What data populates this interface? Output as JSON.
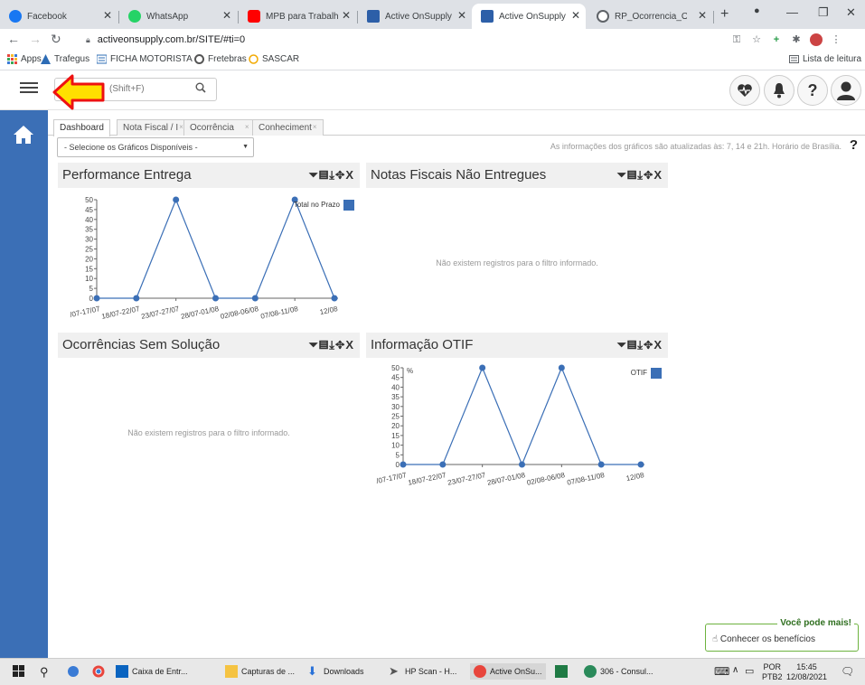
{
  "browser": {
    "tabs": [
      {
        "label": "Facebook",
        "icon": "facebook-icon",
        "color": "#1877f2",
        "active": false
      },
      {
        "label": "WhatsApp",
        "icon": "whatsapp-icon",
        "color": "#25d366",
        "active": false
      },
      {
        "label": "MPB para Trabalhar",
        "icon": "youtube-icon",
        "color": "#ff0000",
        "active": false
      },
      {
        "label": "Active OnSupply",
        "icon": "chart-icon",
        "color": "#2d5fa8",
        "active": false
      },
      {
        "label": "Active OnSupply",
        "icon": "chart-icon",
        "color": "#2d5fa8",
        "active": true
      },
      {
        "label": "RP_Ocorrencia_Oco",
        "icon": "globe-icon",
        "color": "#5f6368",
        "active": false
      }
    ],
    "url": "activeonsupply.com.br/SITE/#ti=0",
    "bookmarks": [
      {
        "label": "Apps",
        "icon": "apps-grid-icon"
      },
      {
        "label": "Trafegus",
        "icon": "trafegus-icon"
      },
      {
        "label": "FICHA MOTORISTA",
        "icon": "ficha-icon"
      },
      {
        "label": "Fretebras",
        "icon": "fretebras-icon"
      },
      {
        "label": "SASCAR",
        "icon": "sascar-icon"
      }
    ],
    "reading_list": "Lista de leitura"
  },
  "app": {
    "search_placeholder": "(Shift+F)",
    "workspace_tabs": [
      "Dashboard",
      "Nota Fiscal / I",
      "Ocorrência",
      "Conheciment"
    ],
    "chart_select": "- Selecione os Gráficos Disponíveis -",
    "update_note": "As informações dos gráficos são atualizadas às: 7, 14 e 21h. Horário de Brasília.",
    "help": "?",
    "panels": {
      "performance": {
        "title": "Performance Entrega"
      },
      "notas": {
        "title": "Notas Fiscais Não Entregues",
        "empty": "Não existem registros para o filtro informado."
      },
      "ocorrencias": {
        "title": "Ocorrências Sem Solução",
        "empty": "Não existem registros para o filtro informado."
      },
      "otif": {
        "title": "Informação OTIF"
      }
    },
    "tools_text": "⏷▤⤓✥X",
    "promo": {
      "title": "Você pode mais!",
      "link": "Conhecer os benefícios"
    },
    "rail_color": "#3b6fb6"
  },
  "chart_data": [
    {
      "type": "line",
      "title": "Performance Entrega",
      "categories": [
        "/07-17/07",
        "18/07-22/07",
        "23/07-27/07",
        "28/07-01/08",
        "02/08-06/08",
        "07/08-11/08",
        "12/08"
      ],
      "series": [
        {
          "name": "Total no Prazo",
          "values": [
            0,
            0,
            50,
            0,
            0,
            50,
            0
          ],
          "color": "#3b6fb6"
        }
      ],
      "yticks": [
        0,
        5,
        10,
        15,
        20,
        25,
        30,
        35,
        40,
        45,
        50
      ],
      "ylim": [
        0,
        50
      ],
      "legend": "top-right"
    },
    {
      "type": "line",
      "title": "Informação OTIF",
      "categories": [
        "/07-17/07",
        "18/07-22/07",
        "23/07-27/07",
        "28/07-01/08",
        "02/08-06/08",
        "07/08-11/08",
        "12/08"
      ],
      "series": [
        {
          "name": "OTIF",
          "values": [
            0,
            0,
            50,
            0,
            50,
            0,
            0
          ],
          "color": "#3b6fb6"
        }
      ],
      "yticks": [
        0,
        5,
        10,
        15,
        20,
        25,
        30,
        35,
        40,
        45,
        50
      ],
      "ylim": [
        0,
        50
      ],
      "ylabel": "%",
      "legend": "top-right"
    }
  ],
  "taskbar": {
    "items": [
      {
        "label": "Caixa de Entr...",
        "icon": "outlook-icon"
      },
      {
        "label": "Capturas de ...",
        "icon": "folder-icon"
      },
      {
        "label": "Downloads",
        "icon": "download-icon"
      },
      {
        "label": "HP Scan - H...",
        "icon": "hp-scan-icon"
      },
      {
        "label": "Active OnSu...",
        "icon": "chrome-icon"
      },
      {
        "label": "306 - Consul...",
        "icon": "app-icon"
      }
    ],
    "lang_top": "POR",
    "lang_bottom": "PTB2",
    "time": "15:45",
    "date": "12/08/2021"
  }
}
